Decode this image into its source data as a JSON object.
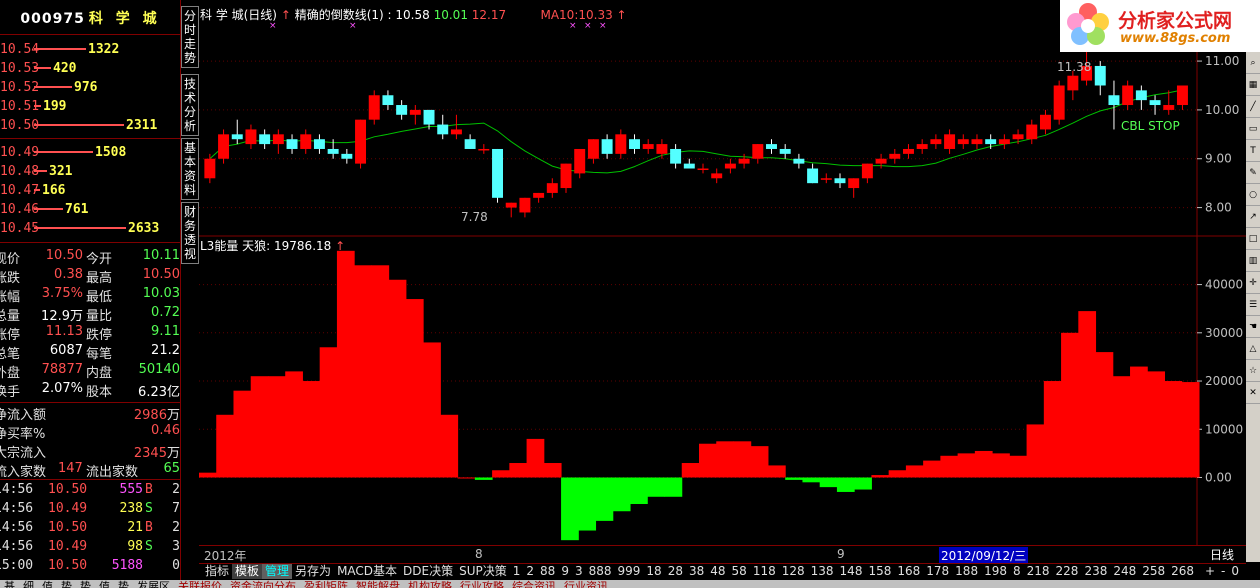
{
  "stock": {
    "code": "000975",
    "name": "科 学 城"
  },
  "order_book": {
    "asks": [
      {
        "price": "10.54",
        "volume": "1322",
        "bar": 0.56
      },
      {
        "price": "10.53",
        "volume": "420",
        "bar": 0.18
      },
      {
        "price": "10.52",
        "volume": "976",
        "bar": 0.41
      },
      {
        "price": "10.51",
        "volume": "199",
        "bar": 0.08
      },
      {
        "price": "10.50",
        "volume": "2311",
        "bar": 0.98
      }
    ],
    "bids": [
      {
        "price": "10.49",
        "volume": "1508",
        "bar": 0.64
      },
      {
        "price": "10.48",
        "volume": "321",
        "bar": 0.14
      },
      {
        "price": "10.47",
        "volume": "166",
        "bar": 0.07
      },
      {
        "price": "10.46",
        "volume": "761",
        "bar": 0.32
      },
      {
        "price": "10.45",
        "volume": "2633",
        "bar": 1.0
      }
    ]
  },
  "quote": [
    {
      "l1": "现价",
      "v1": "10.50",
      "c1": "red",
      "l2": "今开",
      "v2": "10.11",
      "c2": "green"
    },
    {
      "l1": "涨跌",
      "v1": "0.38",
      "c1": "red",
      "l2": "最高",
      "v2": "10.50",
      "c2": "red"
    },
    {
      "l1": "涨幅",
      "v1": "3.75%",
      "c1": "red",
      "l2": "最低",
      "v2": "10.03",
      "c2": "green"
    },
    {
      "l1": "总量",
      "v1": "12.9万",
      "c1": "wht",
      "l2": "量比",
      "v2": "0.72",
      "c2": "green"
    },
    {
      "l1": "涨停",
      "v1": "11.13",
      "c1": "red",
      "l2": "跌停",
      "v2": "9.11",
      "c2": "green"
    },
    {
      "l1": "总笔",
      "v1": "6087",
      "c1": "wht",
      "l2": "每笔",
      "v2": "21.2",
      "c2": "wht"
    },
    {
      "l1": "外盘",
      "v1": "78877",
      "c1": "red",
      "l2": "内盘",
      "v2": "50140",
      "c2": "green"
    },
    {
      "l1": "换手",
      "v1": "2.07%",
      "c1": "wht",
      "l2": "股本",
      "v2": "6.23亿",
      "c2": "wht"
    }
  ],
  "flow": [
    {
      "label": "净流入额",
      "value": "2986",
      "unit": "万"
    },
    {
      "label": "净买率%",
      "value": "0.46",
      "unit": ""
    },
    {
      "label": "大宗流入",
      "value": "2345",
      "unit": "万"
    }
  ],
  "flow_count": {
    "in_label": "流入家数",
    "in_value": "147",
    "out_label": "流出家数",
    "out_value": "65"
  },
  "ticks": [
    {
      "time": "14:56",
      "price": "10.50",
      "vol": "555",
      "vcolor": "mag",
      "bs": "B",
      "n": "2"
    },
    {
      "time": "14:56",
      "price": "10.49",
      "vol": "238",
      "vcolor": "yel",
      "bs": "S",
      "n": "7"
    },
    {
      "time": "14:56",
      "price": "10.50",
      "vol": "21",
      "vcolor": "yel",
      "bs": "B",
      "n": "2"
    },
    {
      "time": "14:56",
      "price": "10.49",
      "vol": "98",
      "vcolor": "yel",
      "bs": "S",
      "n": "3"
    },
    {
      "time": "15:00",
      "price": "10.50",
      "vol": "5188",
      "vcolor": "mag",
      "bs": "",
      "n": "0"
    }
  ],
  "vertical_tabs": [
    "分时走势",
    "技术分析",
    "基本资料",
    "财务透视"
  ],
  "header": {
    "title": "科 学 城(日线)",
    "formula_label": "精确的倒数线(1) :",
    "f1": "10.58",
    "f2": "10.01",
    "f3": "12.17",
    "ma_label": "MA10:",
    "ma_value": "10.33"
  },
  "indicator_header": {
    "label": "L3能量 天狼:",
    "value": "19786.18"
  },
  "chart_annotations": {
    "high": "11.38",
    "low": "7.78",
    "stop": "CBL STOP"
  },
  "price_axis": [
    "11.00",
    "10.00",
    "9.00",
    "8.00"
  ],
  "indicator_axis": [
    "40000",
    "30000",
    "20000",
    "10000",
    "0.00"
  ],
  "date_axis": {
    "year": "2012年",
    "m8": "8",
    "m9": "9",
    "cursor": "2012/09/12/三"
  },
  "period": "日线",
  "tab_bar": [
    "指标",
    "模板",
    "管理",
    "另存为",
    "MACD基本",
    "DDE决策",
    "SUP决策",
    "1",
    "2",
    "88",
    "9",
    "3",
    "888",
    "999",
    "18",
    "28",
    "38",
    "48",
    "58",
    "118",
    "128",
    "138",
    "148",
    "158",
    "168",
    "178",
    "188",
    "198",
    "8",
    "218",
    "228",
    "238",
    "248",
    "258",
    "268"
  ],
  "tab_bar_right": [
    "+",
    "-",
    "0"
  ],
  "bottom_bar": [
    "基",
    "细",
    "值",
    "势",
    "势",
    "值",
    "势",
    "发展区",
    "关联报价",
    "资金流向分布",
    "盈利矩阵",
    "智能解盘",
    "机构攻略",
    "行业攻略",
    "综合资讯",
    "行业资讯"
  ],
  "logo": {
    "brand": "分析家公式网",
    "url": "www.88gs.com"
  },
  "colors": {
    "up": "#ff0000",
    "down": "#54ffff",
    "energy_pos": "#ff0000",
    "energy_neg": "#00ff00",
    "ma": "#00c000",
    "grid": "#800000"
  },
  "chart_data": {
    "type": "bar",
    "candles": [
      [
        8.6,
        9.1,
        8.5,
        9.0
      ],
      [
        9.0,
        9.6,
        8.9,
        9.5
      ],
      [
        9.5,
        9.8,
        9.3,
        9.4
      ],
      [
        9.3,
        9.7,
        9.2,
        9.6
      ],
      [
        9.5,
        9.6,
        9.2,
        9.3
      ],
      [
        9.3,
        9.6,
        9.1,
        9.5
      ],
      [
        9.4,
        9.5,
        9.1,
        9.2
      ],
      [
        9.2,
        9.6,
        9.1,
        9.5
      ],
      [
        9.4,
        9.5,
        9.1,
        9.2
      ],
      [
        9.2,
        9.4,
        9.0,
        9.1
      ],
      [
        9.1,
        9.2,
        8.9,
        9.0
      ],
      [
        8.9,
        9.8,
        8.8,
        9.8
      ],
      [
        9.8,
        10.4,
        9.7,
        10.3
      ],
      [
        10.3,
        10.4,
        10.0,
        10.1
      ],
      [
        10.1,
        10.2,
        9.8,
        9.9
      ],
      [
        9.9,
        10.1,
        9.7,
        10.0
      ],
      [
        10.0,
        10.0,
        9.6,
        9.7
      ],
      [
        9.7,
        9.9,
        9.4,
        9.5
      ],
      [
        9.5,
        9.9,
        9.4,
        9.6
      ],
      [
        9.4,
        9.5,
        9.2,
        9.2
      ],
      [
        9.2,
        9.3,
        9.1,
        9.2
      ],
      [
        9.2,
        9.2,
        8.1,
        8.2
      ],
      [
        8.0,
        8.1,
        7.8,
        8.1
      ],
      [
        7.9,
        8.2,
        7.8,
        8.2
      ],
      [
        8.2,
        8.3,
        8.1,
        8.3
      ],
      [
        8.3,
        8.6,
        8.2,
        8.5
      ],
      [
        8.4,
        8.9,
        8.3,
        8.9
      ],
      [
        8.7,
        9.2,
        8.6,
        9.2
      ],
      [
        9.0,
        9.4,
        8.9,
        9.4
      ],
      [
        9.4,
        9.5,
        9.0,
        9.1
      ],
      [
        9.1,
        9.6,
        9.0,
        9.5
      ],
      [
        9.4,
        9.5,
        9.1,
        9.2
      ],
      [
        9.2,
        9.4,
        9.1,
        9.3
      ],
      [
        9.1,
        9.4,
        9.0,
        9.3
      ],
      [
        9.2,
        9.3,
        8.8,
        8.9
      ],
      [
        8.9,
        9.0,
        8.8,
        8.8
      ],
      [
        8.8,
        8.9,
        8.7,
        8.8
      ],
      [
        8.6,
        8.8,
        8.5,
        8.7
      ],
      [
        8.8,
        9.0,
        8.7,
        8.9
      ],
      [
        8.9,
        9.1,
        8.8,
        9.0
      ],
      [
        9.0,
        9.3,
        8.9,
        9.3
      ],
      [
        9.3,
        9.4,
        9.1,
        9.2
      ],
      [
        9.2,
        9.3,
        9.0,
        9.1
      ],
      [
        9.0,
        9.1,
        8.8,
        8.9
      ],
      [
        8.8,
        8.9,
        8.5,
        8.5
      ],
      [
        8.6,
        8.7,
        8.5,
        8.6
      ],
      [
        8.6,
        8.7,
        8.4,
        8.5
      ],
      [
        8.4,
        8.6,
        8.2,
        8.6
      ],
      [
        8.6,
        8.9,
        8.5,
        8.9
      ],
      [
        8.9,
        9.1,
        8.8,
        9.0
      ],
      [
        9.0,
        9.2,
        8.9,
        9.1
      ],
      [
        9.1,
        9.3,
        9.0,
        9.2
      ],
      [
        9.2,
        9.4,
        9.1,
        9.3
      ],
      [
        9.3,
        9.5,
        9.2,
        9.4
      ],
      [
        9.2,
        9.6,
        9.1,
        9.5
      ],
      [
        9.3,
        9.5,
        9.2,
        9.4
      ],
      [
        9.3,
        9.5,
        9.2,
        9.4
      ],
      [
        9.4,
        9.5,
        9.2,
        9.3
      ],
      [
        9.3,
        9.5,
        9.2,
        9.4
      ],
      [
        9.4,
        9.6,
        9.3,
        9.5
      ],
      [
        9.4,
        9.8,
        9.3,
        9.7
      ],
      [
        9.6,
        10.0,
        9.5,
        9.9
      ],
      [
        9.8,
        10.6,
        9.7,
        10.5
      ],
      [
        10.4,
        10.8,
        10.2,
        10.7
      ],
      [
        10.6,
        11.4,
        10.5,
        10.9
      ],
      [
        10.9,
        11.0,
        10.3,
        10.5
      ],
      [
        10.3,
        10.6,
        9.6,
        10.1
      ],
      [
        10.1,
        10.6,
        10.0,
        10.5
      ],
      [
        10.4,
        10.5,
        10.0,
        10.2
      ],
      [
        10.2,
        10.3,
        9.9,
        10.1
      ],
      [
        10.0,
        10.4,
        9.9,
        10.1
      ],
      [
        10.1,
        10.5,
        10.0,
        10.5
      ]
    ],
    "energy": [
      1000,
      13000,
      18000,
      21000,
      21000,
      22000,
      20000,
      27000,
      47000,
      44000,
      44000,
      41000,
      37000,
      28000,
      13000,
      0,
      -500,
      1500,
      3000,
      8000,
      3000,
      -13000,
      -11000,
      -9000,
      -7000,
      -5500,
      -4000,
      -4000,
      3000,
      7000,
      7500,
      7500,
      6500,
      2500,
      -500,
      -1000,
      -2000,
      -3000,
      -2500,
      500,
      1500,
      2500,
      3500,
      4500,
      5000,
      5500,
      5000,
      4500,
      11000,
      20000,
      30000,
      34500,
      26000,
      21000,
      23000,
      22000,
      20000,
      19786
    ],
    "price_ylim": [
      7.5,
      11.8
    ],
    "energy_ylim": [
      -14000,
      48000
    ],
    "title": "科 学 城(日线)"
  }
}
